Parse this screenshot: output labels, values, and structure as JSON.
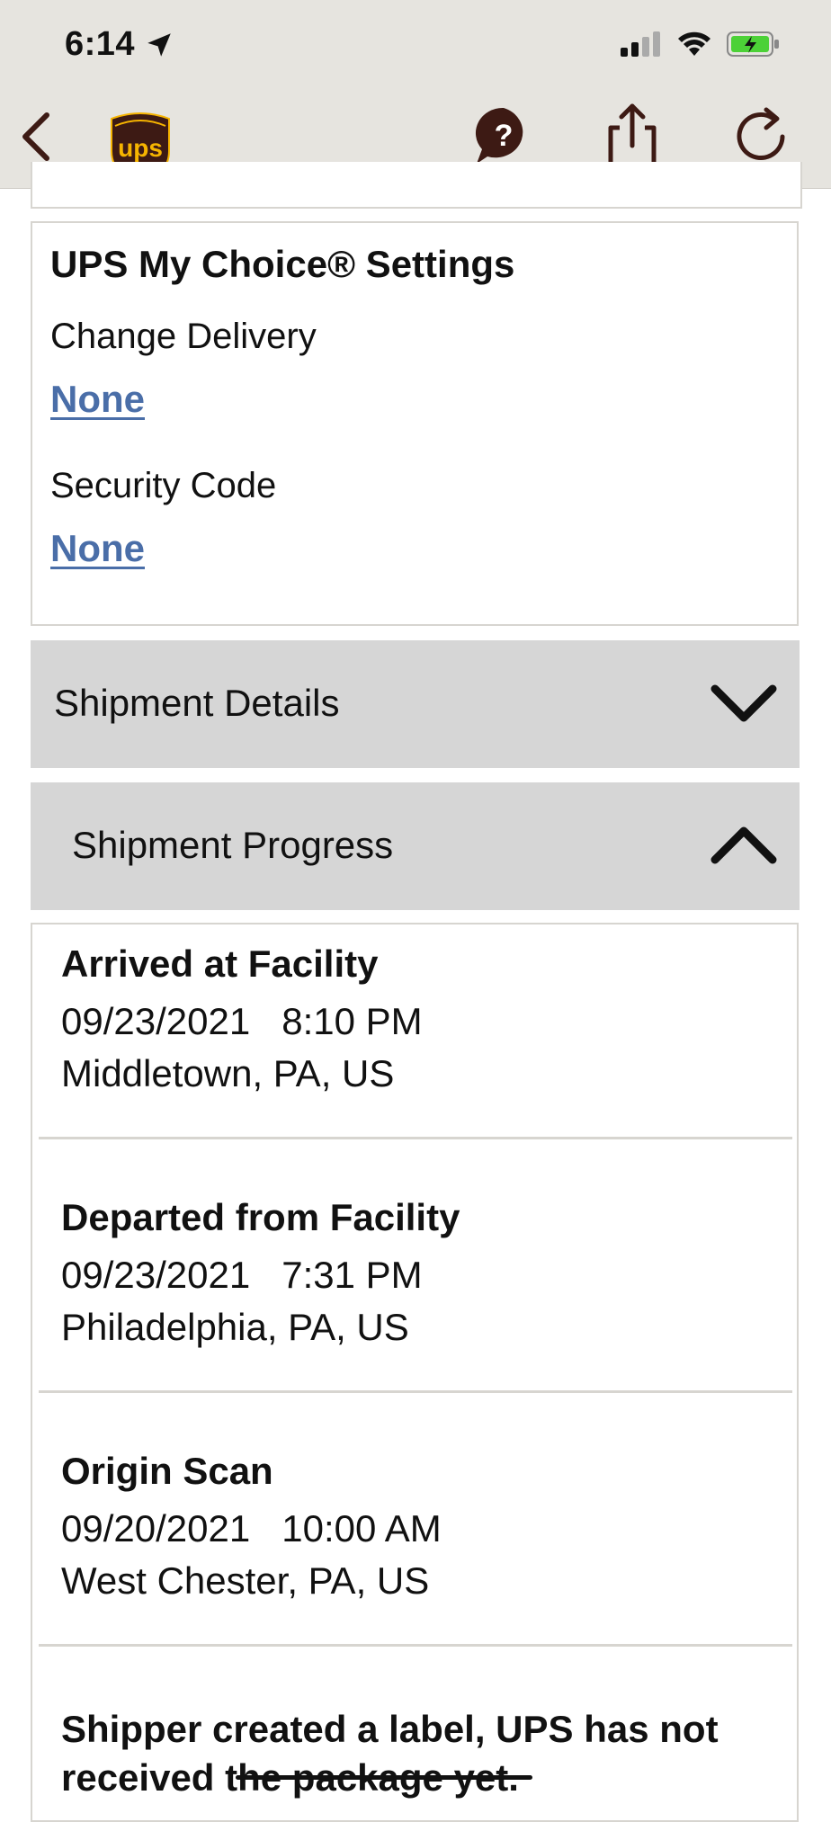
{
  "status_bar": {
    "time": "6:14",
    "icons": [
      "location-arrow-icon",
      "cellular-signal-icon",
      "wifi-icon",
      "battery-charging-icon"
    ]
  },
  "nav": {
    "logo_text": "ups",
    "actions": [
      "back-chevron-icon",
      "help-icon",
      "share-icon",
      "refresh-icon"
    ]
  },
  "settings": {
    "title": "UPS My Choice® Settings",
    "change_delivery_label": "Change Delivery",
    "change_delivery_value": "None",
    "security_code_label": "Security Code",
    "security_code_value": "None"
  },
  "sections": {
    "details_label": "Shipment Details",
    "progress_label": "Shipment Progress"
  },
  "progress": {
    "events": [
      {
        "title": "Arrived at Facility",
        "date": "09/23/2021",
        "time": "8:10 PM",
        "location": "Middletown, PA, US"
      },
      {
        "title": "Departed from Facility",
        "date": "09/23/2021",
        "time": "7:31 PM",
        "location": "Philadelphia, PA, US"
      },
      {
        "title": "Origin Scan",
        "date": "09/20/2021",
        "time": "10:00 AM",
        "location": "West Chester, PA, US"
      }
    ],
    "note": "Shipper created a label, UPS has not received the package yet."
  },
  "colors": {
    "header_bg": "#e6e4df",
    "link": "#4a6ea8",
    "accordion_bg": "#d6d6d6",
    "brand_brown": "#3d1a14",
    "brand_gold": "#f6b400"
  }
}
